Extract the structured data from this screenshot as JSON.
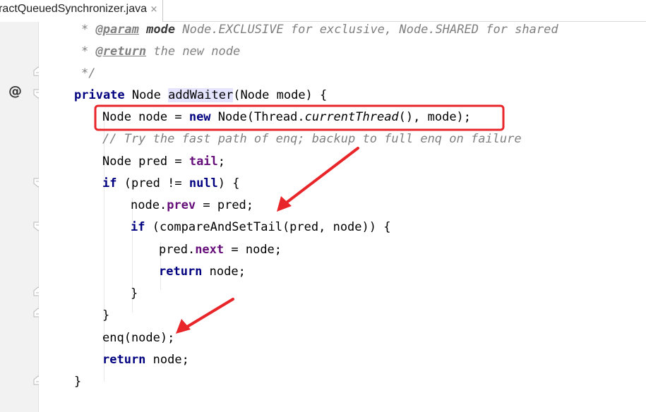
{
  "tab": {
    "label": "ractQueuedSynchronizer.java",
    "close_glyph": "×"
  },
  "gutter": {
    "override_marker": "@"
  },
  "code": {
    "l1_star": "* ",
    "l1_tag": "@param",
    "l1_sp": " ",
    "l1_param": "mode",
    "l1_text": " Node.EXCLUSIVE for exclusive, Node.SHARED for shared",
    "l2_star": "* ",
    "l2_tag": "@return",
    "l2_text": " the new node",
    "l3": "*/",
    "l4_kw": "private",
    "l4_a": " Node ",
    "l4_method": "addWaiter",
    "l4_b": "(Node mode) {",
    "l5_a": "Node node = ",
    "l5_kw": "new",
    "l5_b": " Node(Thread.",
    "l5_call": "currentThread",
    "l5_c": "(), mode);",
    "l6": "// Try the fast path of enq; backup to full enq on failure",
    "l7_a": "Node pred = ",
    "l7_field": "tail",
    "l7_b": ";",
    "l8_kw": "if",
    "l8_a": " (pred != ",
    "l8_kw2": "null",
    "l8_b": ") {",
    "l9_a": "node.",
    "l9_field": "prev",
    "l9_b": " = pred;",
    "l10_kw": "if",
    "l10_a": " (compareAndSetTail(pred, node)) {",
    "l11_a": "pred.",
    "l11_field": "next",
    "l11_b": " = node;",
    "l12_kw": "return",
    "l12_a": " node;",
    "l13": "}",
    "l14": "}",
    "l15": "enq(node);",
    "l16_kw": "return",
    "l16_a": " node;",
    "l17": "}"
  },
  "colors": {
    "keyword": "#000080",
    "field": "#660e7a",
    "comment": "#808080",
    "annotation_box": "#e8262a",
    "method_highlight": "#e4e4ff"
  }
}
